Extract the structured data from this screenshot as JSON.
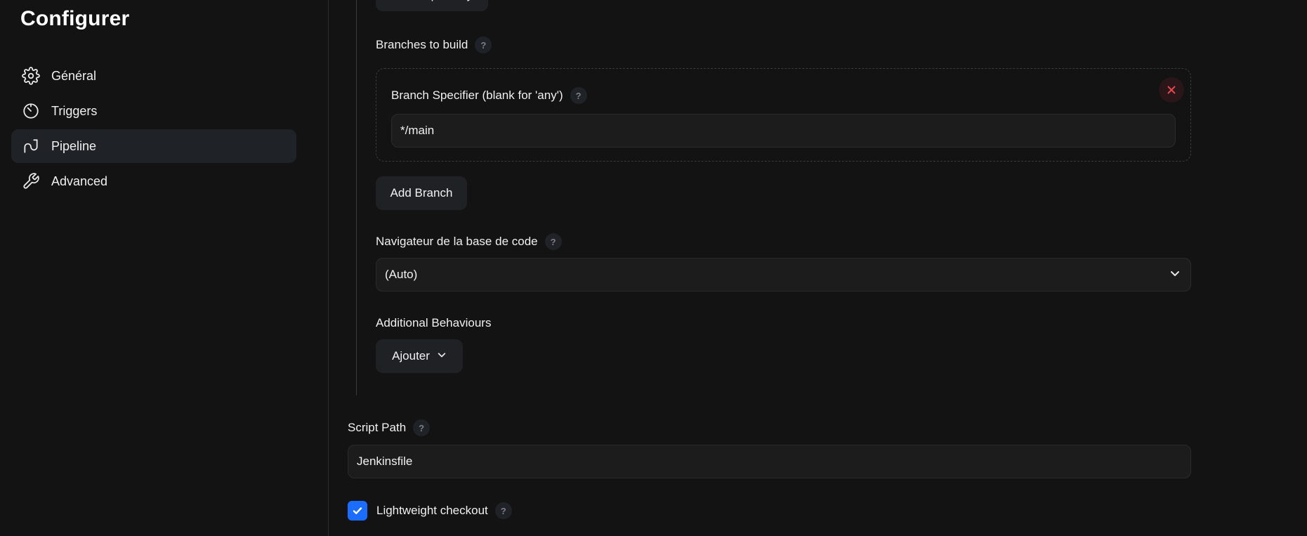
{
  "sidebar": {
    "title": "Configurer",
    "items": [
      {
        "label": "Général",
        "icon": "gear-icon"
      },
      {
        "label": "Triggers",
        "icon": "timer-icon"
      },
      {
        "label": "Pipeline",
        "icon": "pipeline-icon",
        "active": true
      },
      {
        "label": "Advanced",
        "icon": "wrench-icon"
      }
    ]
  },
  "scm": {
    "add_repository_label": "Add Repository",
    "branches_label": "Branches to build",
    "branch_specifier_label": "Branch Specifier (blank for 'any')",
    "branch_specifier_value": "*/main",
    "add_branch_label": "Add Branch",
    "browser_label": "Navigateur de la base de code",
    "browser_value": "(Auto)",
    "behaviours_label": "Additional Behaviours",
    "add_behaviour_label": "Ajouter"
  },
  "script": {
    "path_label": "Script Path",
    "path_value": "Jenkinsfile",
    "lightweight_label": "Lightweight checkout",
    "lightweight_checked": true
  },
  "help_glyph": "?",
  "colors": {
    "background": "#131313",
    "accent": "#1a6dff",
    "danger": "#e5484d"
  }
}
